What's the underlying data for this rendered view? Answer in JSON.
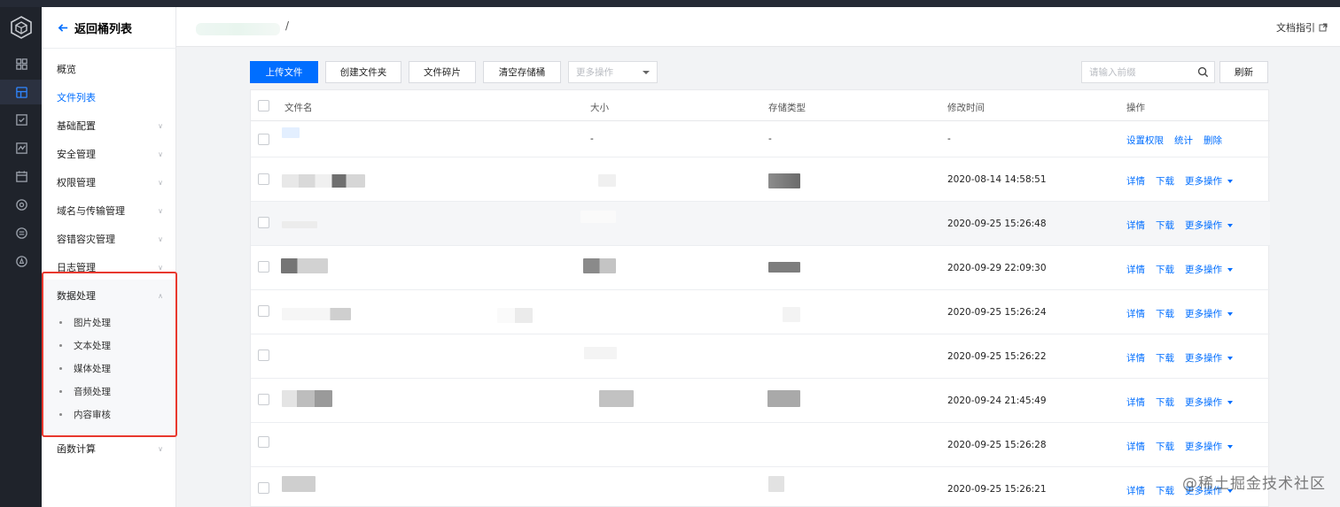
{
  "header": {
    "breadcrumb_separator": "/",
    "doc_link": "文档指引"
  },
  "sidebar": {
    "back_label": "返回桶列表",
    "items": [
      {
        "label": "概览",
        "has_chevron": false
      },
      {
        "label": "文件列表",
        "has_chevron": false,
        "active": true
      },
      {
        "label": "基础配置",
        "has_chevron": true
      },
      {
        "label": "安全管理",
        "has_chevron": true
      },
      {
        "label": "权限管理",
        "has_chevron": true
      },
      {
        "label": "域名与传输管理",
        "has_chevron": true
      },
      {
        "label": "容错容灾管理",
        "has_chevron": true
      },
      {
        "label": "日志管理",
        "has_chevron": true
      },
      {
        "label": "数据处理",
        "has_chevron": true,
        "expanded": true
      },
      {
        "label": "函数计算",
        "has_chevron": true
      }
    ],
    "data_processing_subitems": [
      "图片处理",
      "文本处理",
      "媒体处理",
      "音频处理",
      "内容审核"
    ]
  },
  "toolbar": {
    "upload_label": "上传文件",
    "create_folder_label": "创建文件夹",
    "fragments_label": "文件碎片",
    "clear_bucket_label": "清空存储桶",
    "more_ops_placeholder": "更多操作",
    "search_placeholder": "请输入前缀",
    "refresh_label": "刷新"
  },
  "table": {
    "columns": {
      "name": "文件名",
      "size": "大小",
      "storage_class": "存储类型",
      "modified": "修改时间",
      "actions": "操作"
    },
    "folder_row": {
      "size": "-",
      "storage_class": "-",
      "modified": "-",
      "actions": [
        "设置权限",
        "统计",
        "删除"
      ]
    },
    "rows": [
      {
        "modified": "2020-08-14 14:58:51"
      },
      {
        "modified": "2020-09-25 15:26:48"
      },
      {
        "modified": "2020-09-29 22:09:30"
      },
      {
        "modified": "2020-09-25 15:26:24"
      },
      {
        "modified": "2020-09-25 15:26:22"
      },
      {
        "modified": "2020-09-24 21:45:49"
      },
      {
        "modified": "2020-09-25 15:26:28"
      },
      {
        "modified": "2020-09-25 15:26:21"
      }
    ],
    "row_actions": {
      "details": "详情",
      "download": "下载",
      "more": "更多操作"
    }
  },
  "watermark": "@稀土掘金技术社区",
  "colors": {
    "accent": "#006eff",
    "highlight_border": "#e8382e",
    "rail_bg": "#1f232b"
  },
  "icons": [
    "cube-logo-icon",
    "dashboard-icon",
    "bucket-icon",
    "task-icon",
    "monitor-icon",
    "calendar-icon",
    "analytics-icon",
    "list-icon",
    "key-icon",
    "arrow-left-icon",
    "external-link-icon",
    "search-icon"
  ]
}
